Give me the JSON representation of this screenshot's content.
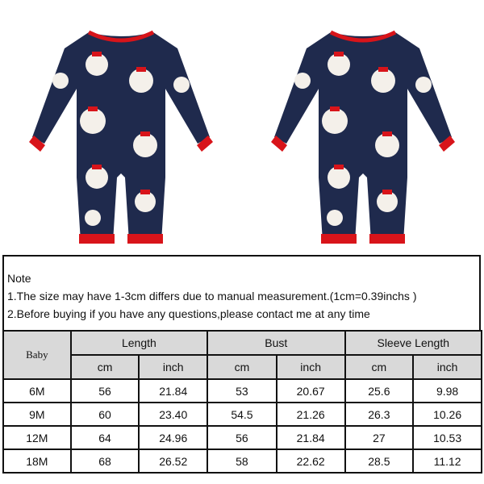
{
  "product_images": [
    {
      "name": "romper-front",
      "icon": "snowman-romper-icon"
    },
    {
      "name": "romper-back",
      "icon": "snowman-romper-icon"
    }
  ],
  "colors": {
    "romper_body": "#1f2a4d",
    "romper_trim": "#d8141a",
    "header_fill": "#d9d9d9"
  },
  "note": {
    "title": "Note",
    "line1": "1.The size may have 1-3cm differs due to manual measurement.(1cm=0.39inchs )",
    "line2": "2.Before buying if you have any questions,please contact me at any time"
  },
  "table": {
    "corner": "Baby",
    "groups": [
      "Length",
      "Bust",
      "Sleeve Length"
    ],
    "units": [
      "cm",
      "inch",
      "cm",
      "inch",
      "cm",
      "inch"
    ],
    "rows": [
      [
        "6M",
        "56",
        "21.84",
        "53",
        "20.67",
        "25.6",
        "9.98"
      ],
      [
        "9M",
        "60",
        "23.40",
        "54.5",
        "21.26",
        "26.3",
        "10.26"
      ],
      [
        "12M",
        "64",
        "24.96",
        "56",
        "21.84",
        "27",
        "10.53"
      ],
      [
        "18M",
        "68",
        "26.52",
        "58",
        "22.62",
        "28.5",
        "11.12"
      ]
    ]
  }
}
